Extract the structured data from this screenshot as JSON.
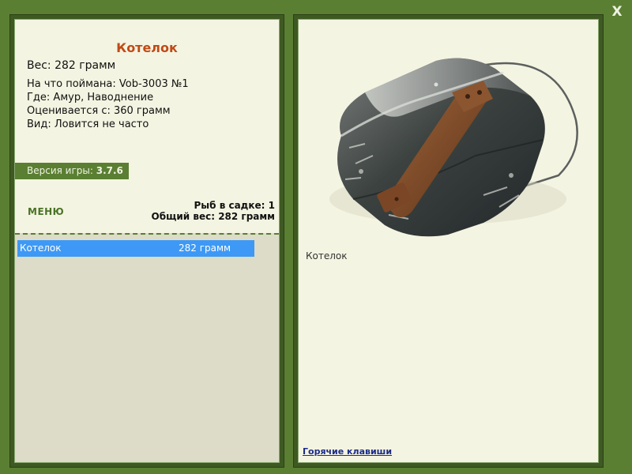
{
  "window": {
    "close_label": "X"
  },
  "item": {
    "title": "Котелок",
    "weight_line": "Вес: 282 грамм",
    "caught_with": "На что поймана: Vob-3003 №1",
    "location": "Где: Амур, Наводнение",
    "valued_from": "Оценивается с: 360 грамм",
    "rarity": "Вид: Ловится не часто"
  },
  "version": {
    "label": "Версия игры:",
    "value": "3.7.6"
  },
  "menu": {
    "label": "МЕНЮ"
  },
  "stats": {
    "fish_count": "Рыб в садке: 1",
    "total_weight": "Общий вес: 282 грамм"
  },
  "list": {
    "items": [
      {
        "name": "Котелок",
        "weight": "282 грамм",
        "selected": true
      }
    ]
  },
  "preview": {
    "image_icon": "mess-tin-icon",
    "caption": "Котелок"
  },
  "footer": {
    "hotkeys_label": "Горячие клавиши"
  },
  "colors": {
    "background": "#5a7f32",
    "panel": "#f4f4e2",
    "title_accent": "#c04a16",
    "selection": "#3d99f5",
    "link": "#1c2b88"
  }
}
